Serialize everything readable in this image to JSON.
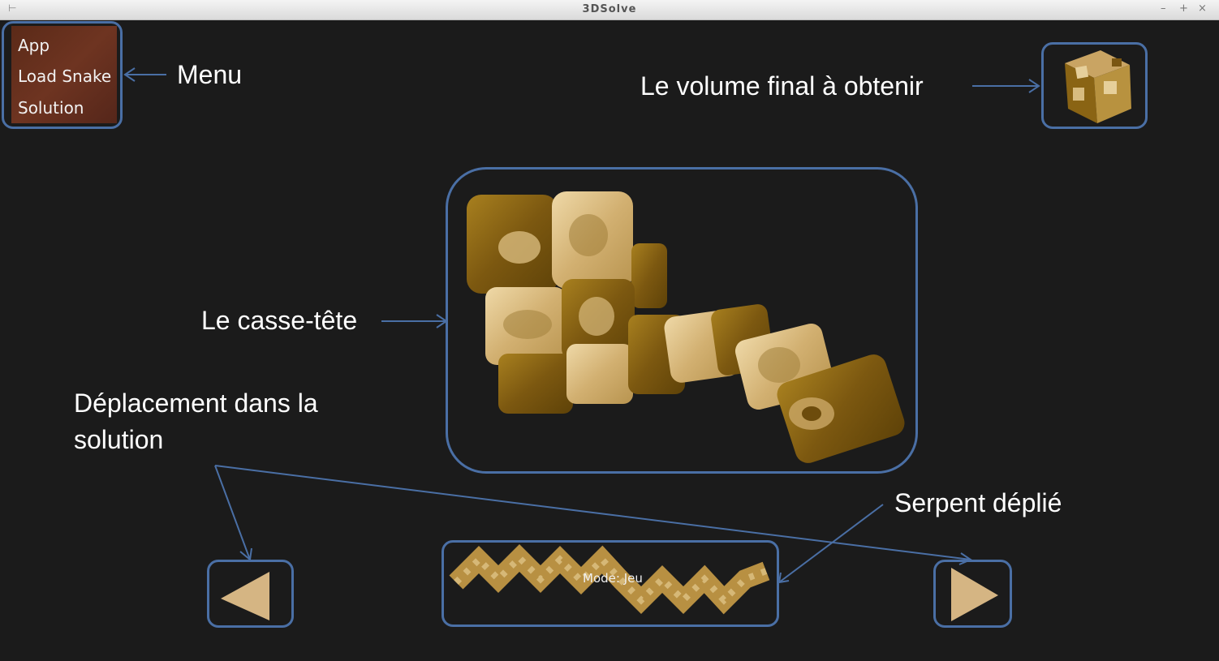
{
  "window": {
    "title": "3DSolve",
    "controls": [
      "–",
      "+",
      "×"
    ]
  },
  "menu": {
    "items": [
      {
        "label": "App"
      },
      {
        "label": "Load Snake"
      },
      {
        "label": "Solution"
      }
    ]
  },
  "annotations": {
    "menu": "Menu",
    "target_volume": "Le volume final à obtenir",
    "puzzle": "Le casse-tête",
    "navigation": "Déplacement  dans la solution",
    "unfolded_snake": "Serpent déplié"
  },
  "snake_strip": {
    "mode_label": "Mode: Jeu"
  },
  "navigation": {
    "prev_icon": "triangle-left-icon",
    "next_icon": "triangle-right-icon"
  },
  "colors": {
    "background": "#1b1b1b",
    "highlight": "#4a6fa5",
    "menu_bg": "#6e3421",
    "wood_dark": "#8a6414",
    "wood_light": "#d9b97a"
  }
}
